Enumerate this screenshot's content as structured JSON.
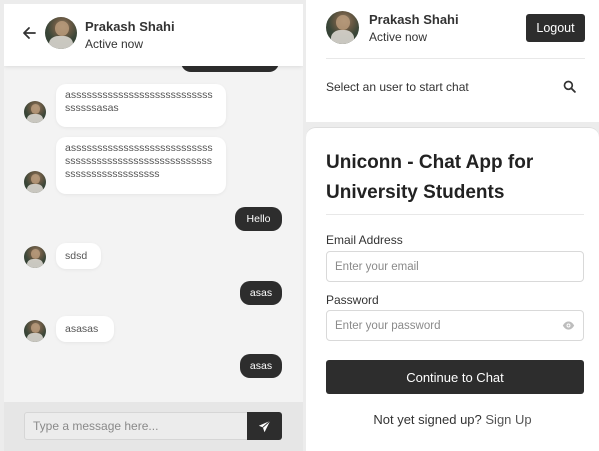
{
  "chat": {
    "header": {
      "name": "Prakash Shahi",
      "status": "Active now"
    },
    "messages": [
      {
        "from": "them",
        "text": "asssssssssssssssssssssssssssssssssasas"
      },
      {
        "from": "them",
        "text": "asssssssssssssssssssssssssssssssssssssssssssssssssssssssssssssssssssssssss"
      },
      {
        "from": "me",
        "text": "Hello"
      },
      {
        "from": "them",
        "text": "sdsd"
      },
      {
        "from": "me",
        "text": "asas"
      },
      {
        "from": "them",
        "text": "asasas"
      },
      {
        "from": "me",
        "text": "asas"
      }
    ],
    "composer": {
      "placeholder": "Type a message here..."
    }
  },
  "sidebar": {
    "user": {
      "name": "Prakash Shahi",
      "status": "Active now"
    },
    "logout_label": "Logout",
    "select_prompt": "Select an user to start chat"
  },
  "login": {
    "title": "Uniconn - Chat App for University Students",
    "email_label": "Email Address",
    "email_placeholder": "Enter your email",
    "password_label": "Password",
    "password_placeholder": "Enter your password",
    "continue_label": "Continue to Chat",
    "signup_prompt": "Not yet signed up?",
    "signup_link": "Sign Up"
  },
  "icons": {
    "back": "arrow-left-icon",
    "send": "paper-plane-icon",
    "search": "search-icon",
    "eye": "eye-icon"
  },
  "colors": {
    "accent": "#2d2d2d",
    "bubble_in": "#ffffff",
    "background": "#ececec"
  }
}
